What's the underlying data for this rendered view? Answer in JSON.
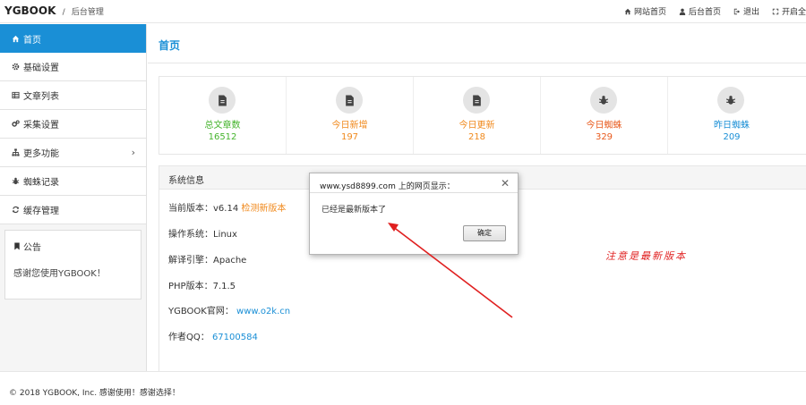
{
  "header": {
    "brand": "YGBOOK",
    "separator": "/",
    "subtitle": "后台管理",
    "nav": [
      {
        "icon": "home-icon",
        "label": "网站首页"
      },
      {
        "icon": "user-icon",
        "label": "后台首页"
      },
      {
        "icon": "logout-icon",
        "label": "退出"
      },
      {
        "icon": "fullscreen-icon",
        "label": "开启全"
      }
    ]
  },
  "sidebar": {
    "items": [
      {
        "icon": "home-icon",
        "label": "首页"
      },
      {
        "icon": "gear-icon",
        "label": "基础设置"
      },
      {
        "icon": "list-icon",
        "label": "文章列表"
      },
      {
        "icon": "cogs-icon",
        "label": "采集设置"
      },
      {
        "icon": "sitemap-icon",
        "label": "更多功能",
        "chevron": "›"
      },
      {
        "icon": "bug-icon",
        "label": "蜘蛛记录"
      },
      {
        "icon": "refresh-icon",
        "label": "缓存管理"
      }
    ],
    "notice": {
      "title": "公告",
      "body": "感谢您使用YGBOOK！"
    }
  },
  "main": {
    "title": "首页",
    "stats": [
      {
        "label": "总文章数",
        "value": "16512",
        "color": "#45b42d",
        "icon": "file-icon"
      },
      {
        "label": "今日新增",
        "value": "197",
        "color": "#f0891c",
        "icon": "file-icon"
      },
      {
        "label": "今日更新",
        "value": "218",
        "color": "#f0891c",
        "icon": "file-icon"
      },
      {
        "label": "今日蜘蛛",
        "value": "329",
        "color": "#e85a1d",
        "icon": "bug-icon"
      },
      {
        "label": "昨日蜘蛛",
        "value": "209",
        "color": "#1a8fd6",
        "icon": "bug-icon"
      }
    ],
    "sysinfo": {
      "heading": "系统信息",
      "version_label": "当前版本：v6.14",
      "check_update": "检测新版本",
      "os": "操作系统：Linux",
      "engine": "解译引擎：Apache",
      "php": "PHP版本：7.1.5",
      "site_label": "YGBOOK官网：",
      "site_url": "www.o2k.cn",
      "qq_label": "作者QQ：",
      "qq": "67100584"
    }
  },
  "dialog": {
    "title": "www.ysd8899.com 上的网页显示：",
    "message": "已经是最新版本了",
    "ok": "确定"
  },
  "annotation": "注意是最新版本",
  "footer": "© 2018 YGBOOK, Inc. 感谢使用！感谢选择！"
}
